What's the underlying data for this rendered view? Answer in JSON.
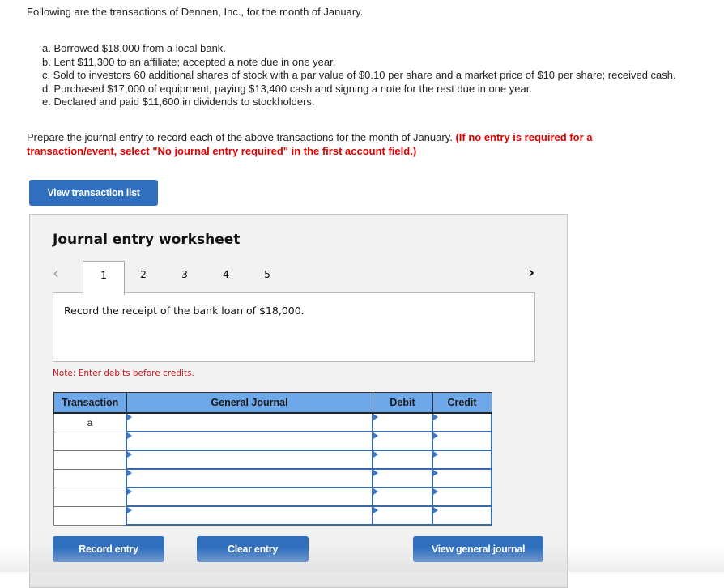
{
  "intro": "Following are the transactions of Dennen, Inc., for the month of January.",
  "transactions": [
    "a. Borrowed $18,000 from a local bank.",
    "b. Lent $11,300 to an affiliate; accepted a note due in one year.",
    "c. Sold to investors 60 additional shares of stock with a par value of $0.10 per share and a market price of $10 per share; received cash.",
    "d. Purchased $17,000 of equipment, paying $13,400 cash and signing a note for the rest due in one year.",
    "e. Declared and paid $11,600 in dividends to stockholders."
  ],
  "instructions": {
    "text": "Prepare the journal entry to record each of the above transactions for the month of January. ",
    "emphasis": "(If no entry is required for a transaction/event, select \"No journal entry required\" in the first account field.)"
  },
  "view_transaction_list_label": "View transaction list",
  "worksheet": {
    "title": "Journal entry worksheet",
    "prev_icon": "‹",
    "next_icon": "›",
    "tabs": [
      "1",
      "2",
      "3",
      "4",
      "5"
    ],
    "active_tab": "1",
    "description": "Record the receipt of the bank loan of $18,000.",
    "note": "Note: Enter debits before credits.",
    "table": {
      "headers": [
        "Transaction",
        "General Journal",
        "Debit",
        "Credit"
      ],
      "rows": [
        {
          "transaction": "a",
          "account": "",
          "debit": "",
          "credit": ""
        },
        {
          "transaction": "",
          "account": "",
          "debit": "",
          "credit": ""
        },
        {
          "transaction": "",
          "account": "",
          "debit": "",
          "credit": ""
        },
        {
          "transaction": "",
          "account": "",
          "debit": "",
          "credit": ""
        },
        {
          "transaction": "",
          "account": "",
          "debit": "",
          "credit": ""
        },
        {
          "transaction": "",
          "account": "",
          "debit": "",
          "credit": ""
        }
      ]
    },
    "buttons": {
      "record": "Record entry",
      "clear": "Clear entry",
      "view_general_journal": "View general journal"
    }
  },
  "colors": {
    "button_blue": "#2f6fbe",
    "header_blue": "#6ea8e8",
    "warning_red": "#e00000",
    "note_red": "#c2171d"
  }
}
